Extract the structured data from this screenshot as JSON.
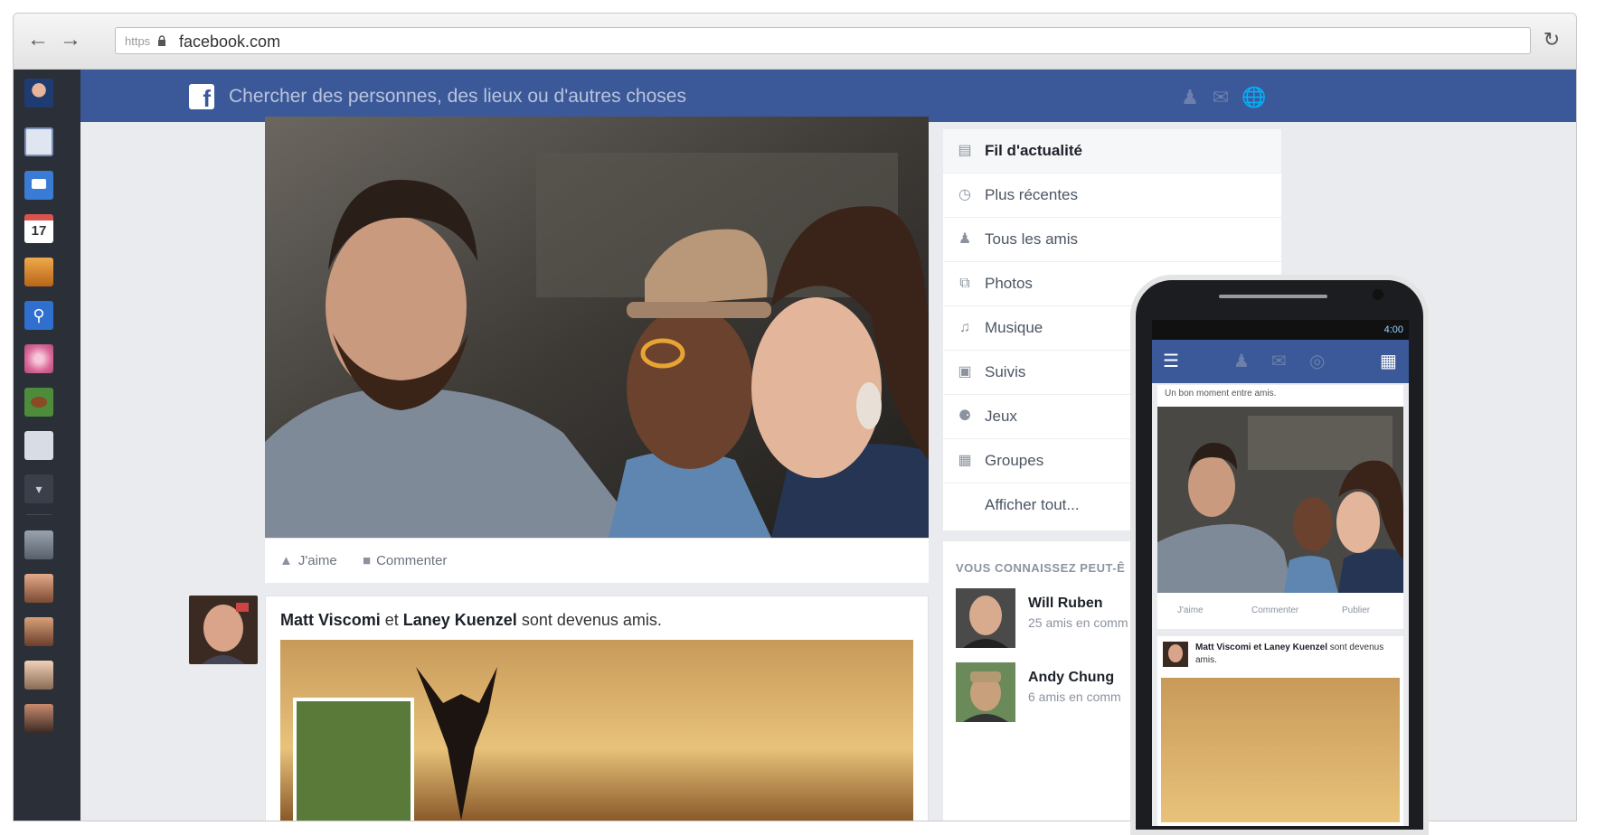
{
  "browser": {
    "url_protocol": "https",
    "url": "facebook.com"
  },
  "topbar": {
    "search_placeholder": "Chercher des personnes, des lieux ou d'autres choses"
  },
  "post": {
    "like_label": "J'aime",
    "comment_label": "Commenter"
  },
  "story": {
    "person1": "Matt Viscomi",
    "connector": "et",
    "person2": "Laney Kuenzel",
    "action": "sont devenus amis."
  },
  "right_nav": {
    "items": [
      {
        "label": "Fil d'actualité",
        "icon": "news-feed-icon"
      },
      {
        "label": "Plus récentes",
        "icon": "clock-icon"
      },
      {
        "label": "Tous les amis",
        "icon": "friends-icon"
      },
      {
        "label": "Photos",
        "icon": "photos-icon"
      },
      {
        "label": "Musique",
        "icon": "music-icon"
      },
      {
        "label": "Suivis",
        "icon": "following-icon"
      },
      {
        "label": "Jeux",
        "icon": "games-icon"
      },
      {
        "label": "Groupes",
        "icon": "groups-icon"
      },
      {
        "label": "Afficher tout...",
        "icon": ""
      }
    ]
  },
  "pymk": {
    "title": "VOUS CONNAISSEZ PEUT-Ê",
    "people": [
      {
        "name": "Will Ruben",
        "sub": "25 amis en comm"
      },
      {
        "name": "Andy Chung",
        "sub": "6 amis en comm"
      }
    ]
  },
  "phone": {
    "status_time": "4:00",
    "caption": "Un bon moment entre amis.",
    "like_label": "J'aime",
    "comment_label": "Commenter",
    "share_label": "Publier",
    "story_text_names": "Matt Viscomi et Laney Kuenzel",
    "story_text_action": "sont devenus amis."
  },
  "colors": {
    "facebook_blue": "#3b5998",
    "sidebar_dark": "#2b2f38",
    "background": "#e9ebee"
  },
  "sidebar": {
    "calendar_day": "17"
  }
}
